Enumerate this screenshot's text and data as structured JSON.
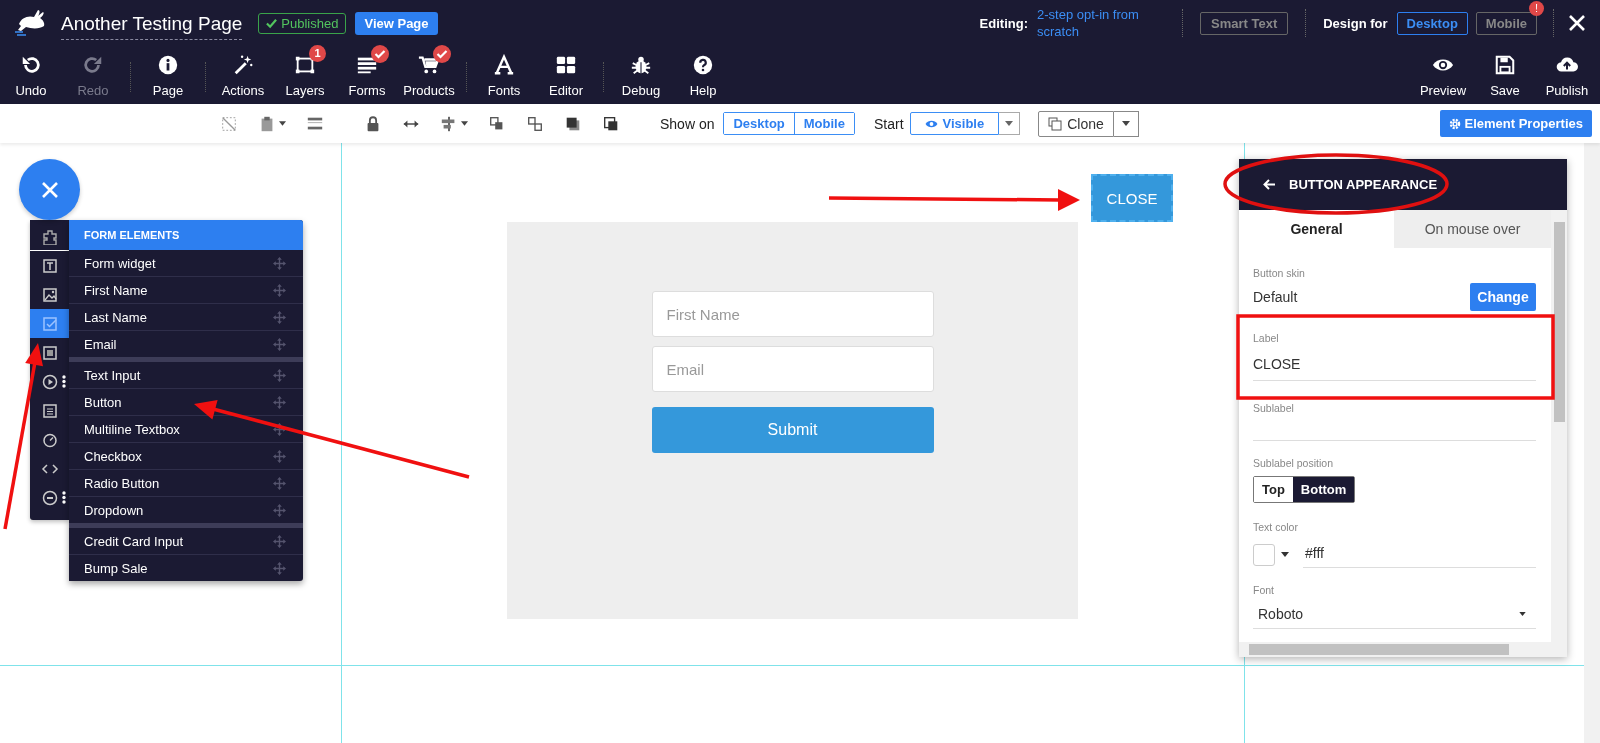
{
  "header": {
    "title": "Another Testing Page",
    "status": "Published",
    "view_button": "View Page",
    "editing_label": "Editing:",
    "editing_name": "2-step opt-in from scratch",
    "smart_text": "Smart Text",
    "design_for_label": "Design for",
    "design_modes": [
      {
        "label": "Desktop",
        "selected": true
      },
      {
        "label": "Mobile",
        "selected": false,
        "badge": "!"
      }
    ]
  },
  "toolbar": {
    "groups": [
      [
        {
          "label": "Undo",
          "disabled": false,
          "verified": false
        },
        {
          "label": "Redo",
          "disabled": true,
          "verified": false
        }
      ],
      [
        {
          "label": "Page",
          "disabled": false,
          "verified": false
        }
      ],
      [
        {
          "label": "Actions",
          "disabled": false,
          "verified": false
        },
        {
          "label": "Layers",
          "disabled": false,
          "verified": false,
          "badge": "1"
        },
        {
          "label": "Forms",
          "disabled": false,
          "verified": true
        },
        {
          "label": "Products",
          "disabled": false,
          "verified": true
        }
      ],
      [
        {
          "label": "Fonts",
          "disabled": false,
          "verified": false
        },
        {
          "label": "Editor",
          "disabled": false,
          "verified": false
        }
      ],
      [
        {
          "label": "Debug",
          "disabled": false,
          "verified": false
        },
        {
          "label": "Help",
          "disabled": false,
          "verified": false
        }
      ]
    ],
    "right": [
      {
        "label": "Preview"
      },
      {
        "label": "Save"
      },
      {
        "label": "Publish"
      }
    ]
  },
  "edit_bar": {
    "show_on_label": "Show on",
    "show_on": [
      "Desktop",
      "Mobile"
    ],
    "start_label": "Start",
    "visibility": "Visible",
    "clone": "Clone",
    "properties_button": "Element Properties"
  },
  "side_rail": [
    {
      "selected": false,
      "more": false
    },
    {
      "selected": false,
      "more": false
    },
    {
      "selected": false,
      "more": false
    },
    {
      "selected": true,
      "more": false
    },
    {
      "selected": false,
      "more": false
    },
    {
      "selected": false,
      "more": true
    },
    {
      "selected": false,
      "more": false
    },
    {
      "selected": false,
      "more": false
    },
    {
      "selected": false,
      "more": false
    },
    {
      "selected": false,
      "more": true
    }
  ],
  "form_elements": {
    "title": "FORM ELEMENTS",
    "groups": [
      [
        "Form widget",
        "First Name",
        "Last Name",
        "Email"
      ],
      [
        "Text Input",
        "Button",
        "Multiline Textbox",
        "Checkbox",
        "Radio Button",
        "Dropdown"
      ],
      [
        "Credit Card Input",
        "Bump Sale"
      ]
    ]
  },
  "canvas": {
    "close_button": "CLOSE",
    "fields": [
      {
        "placeholder": "First Name"
      },
      {
        "placeholder": "Email"
      }
    ],
    "submit": "Submit"
  },
  "panel": {
    "title": "BUTTON APPEARANCE",
    "tabs": [
      {
        "label": "General",
        "selected": true
      },
      {
        "label": "On mouse over",
        "selected": false
      }
    ],
    "skin_label": "Button skin",
    "skin_value": "Default",
    "change_button": "Change",
    "label_label": "Label",
    "label_value": "CLOSE",
    "sublabel_label": "Sublabel",
    "sublabel_position_label": "Sublabel position",
    "sublabel_positions": [
      {
        "label": "Top",
        "selected": false
      },
      {
        "label": "Bottom",
        "selected": true
      }
    ],
    "text_color_label": "Text color",
    "text_color": "#fff",
    "font_label": "Font",
    "font_value": "Roboto"
  }
}
